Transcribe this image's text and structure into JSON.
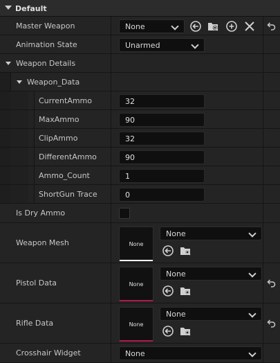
{
  "header": {
    "category": "Default"
  },
  "master_weapon": {
    "label": "Master Weapon",
    "value": "None"
  },
  "animation_state": {
    "label": "Animation State",
    "value": "Unarmed"
  },
  "weapon_details": {
    "label": "Weapon Details"
  },
  "weapon_data": {
    "label": "Weapon_Data",
    "fields": [
      {
        "label": "CurrentAmmo",
        "value": "32"
      },
      {
        "label": "MaxAmmo",
        "value": "90"
      },
      {
        "label": "ClipAmmo",
        "value": "32"
      },
      {
        "label": "DifferentAmmo",
        "value": "90"
      },
      {
        "label": "Ammo_Count",
        "value": "1"
      },
      {
        "label": "ShortGun Trace",
        "value": "0"
      }
    ]
  },
  "is_dry_ammo": {
    "label": "Is Dry Ammo",
    "checked": false
  },
  "weapon_mesh": {
    "label": "Weapon Mesh",
    "thumb": "None",
    "value": "None",
    "accent": "#ffffff"
  },
  "pistol_data": {
    "label": "Pistol Data",
    "thumb": "None",
    "value": "None",
    "accent": "#b0194d"
  },
  "rifle_data": {
    "label": "Rifle Data",
    "thumb": "None",
    "value": "None",
    "accent": "#b0194d"
  },
  "crosshair_widget": {
    "label": "Crosshair Widget",
    "value": "None"
  },
  "icons": [
    "use-selected-icon",
    "browse-icon",
    "add-icon",
    "clear-icon",
    "reset-to-default-icon"
  ]
}
